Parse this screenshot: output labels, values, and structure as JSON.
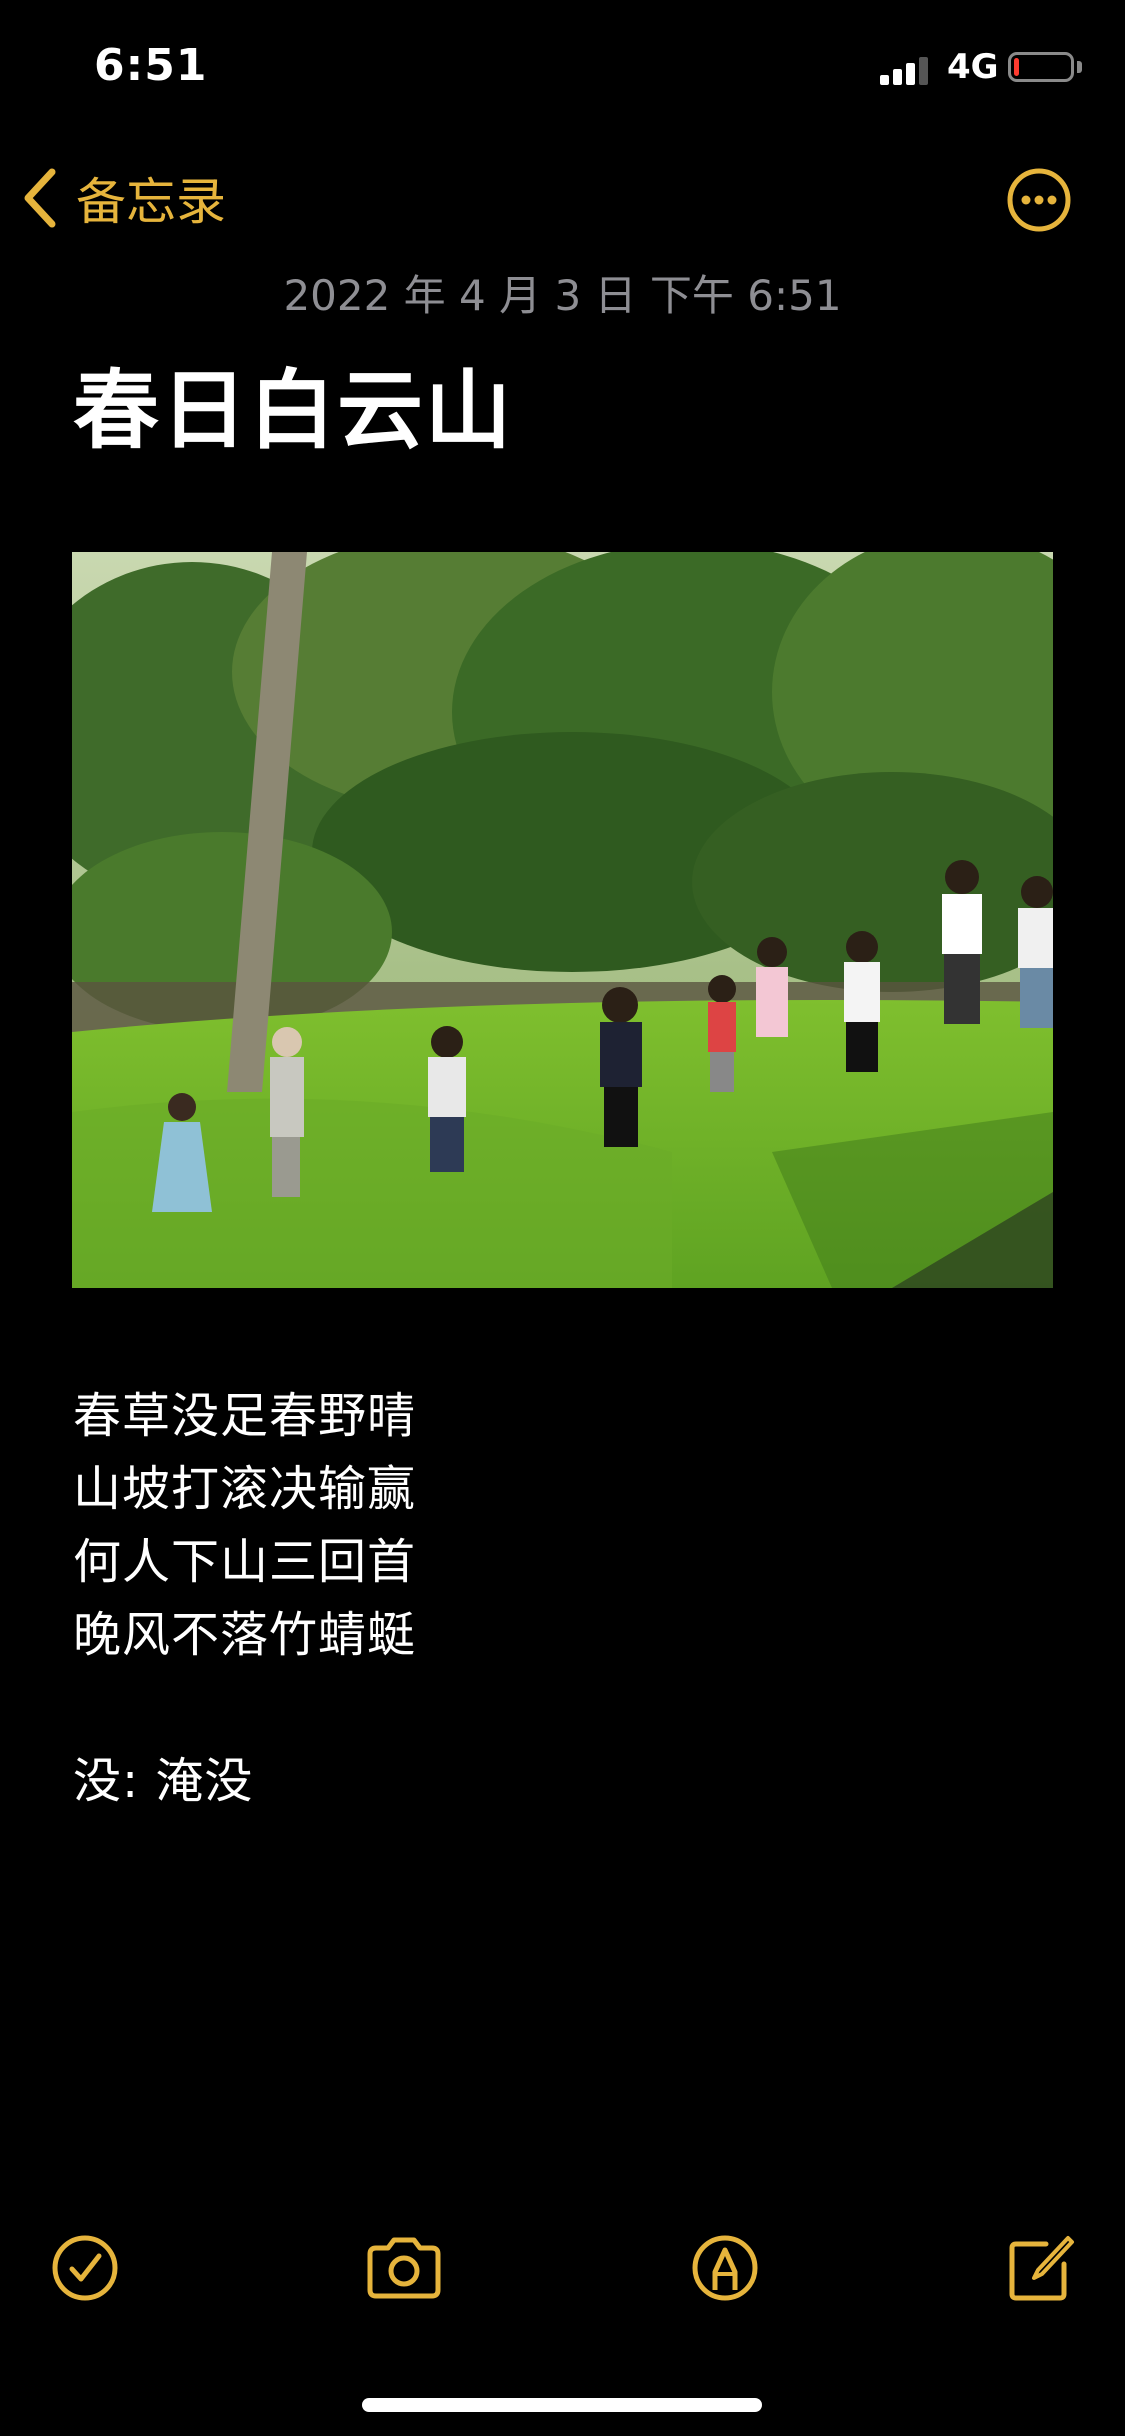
{
  "status_bar": {
    "time": "6:51",
    "network": "4G",
    "signal_bars": 3,
    "battery_level": 0.1
  },
  "nav": {
    "back_label": "备忘录",
    "more_icon": "ellipsis-circle-icon"
  },
  "note": {
    "date": "2022 年 4 月 3 日 下午 6:51",
    "title": "春日白云山",
    "body_lines": [
      "春草没足春野晴",
      "山坡打滚决输赢",
      "何人下山三回首",
      "晚风不落竹蜻蜓"
    ],
    "footnote": "没: 淹没"
  },
  "toolbar": {
    "icons": [
      "checklist-icon",
      "camera-icon",
      "markup-icon",
      "compose-icon"
    ]
  },
  "colors": {
    "accent": "#e6b43c",
    "background": "#000000",
    "secondary_text": "#8e8e93",
    "battery_low": "#ff3b30"
  }
}
